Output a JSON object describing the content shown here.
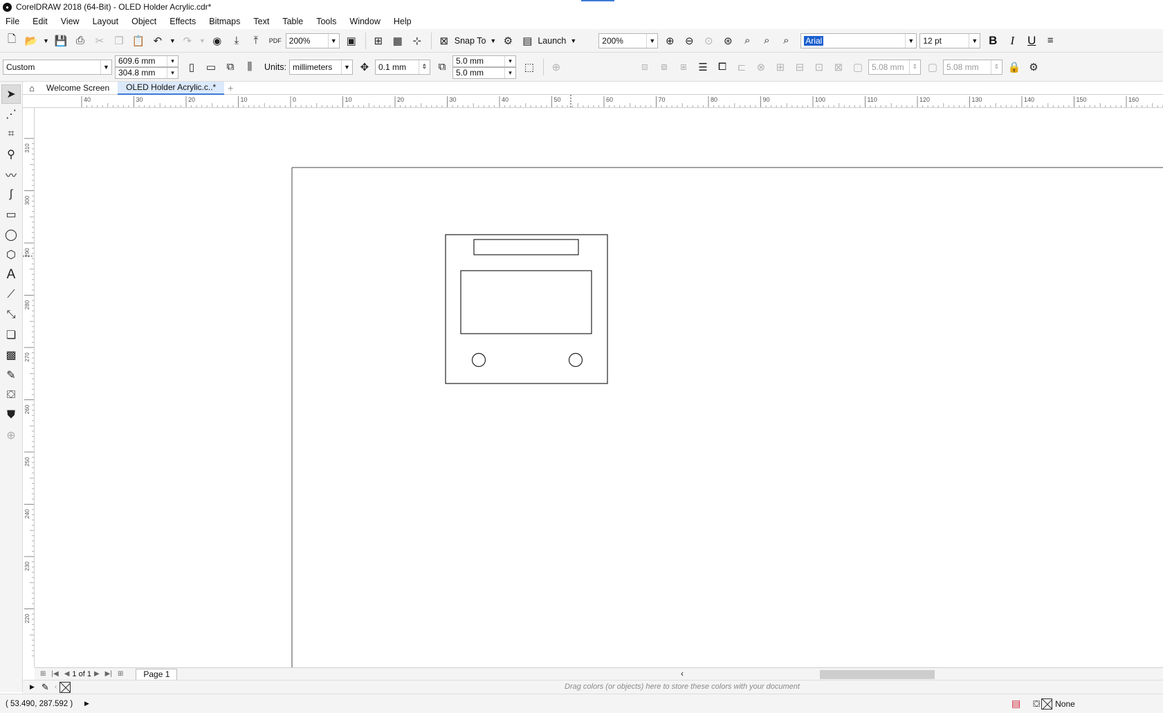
{
  "window": {
    "title": "CorelDRAW 2018 (64-Bit) - OLED Holder Acrylic.cdr*"
  },
  "menu": [
    "File",
    "Edit",
    "View",
    "Layout",
    "Object",
    "Effects",
    "Bitmaps",
    "Text",
    "Table",
    "Tools",
    "Window",
    "Help"
  ],
  "toolbar": {
    "zoom_combo": "200%",
    "snap_to": "Snap To",
    "launch": "Launch",
    "zoom_combo2": "200%",
    "font_name": "Arial",
    "font_size": "12 pt",
    "bold": "B",
    "italic": "I",
    "underline": "U"
  },
  "propbar": {
    "page_preset": "Custom",
    "width": "609.6 mm",
    "height": "304.8 mm",
    "units_label": "Units:",
    "units": "millimeters",
    "nudge": "0.1 mm",
    "dup_x": "5.0 mm",
    "dup_y": "5.0 mm",
    "corner1": "5.08 mm",
    "corner2": "5.08 mm"
  },
  "doc_tabs": {
    "welcome": "Welcome Screen",
    "document": "OLED Holder Acrylic.c..*"
  },
  "rulers": {
    "horizontal": [
      "40",
      "30",
      "20",
      "10",
      "0",
      "10",
      "20",
      "30",
      "40",
      "50",
      "60",
      "70",
      "80",
      "90",
      "100",
      "110",
      "120",
      "130",
      "140",
      "150",
      "160"
    ],
    "vertical": [
      "310",
      "300",
      "290",
      "280",
      "270",
      "260",
      "250",
      "240",
      "230",
      "220"
    ]
  },
  "page_nav": {
    "current": "1",
    "of_label": "of",
    "total": "1",
    "page_tab": "Page 1"
  },
  "palette": {
    "hint": "Drag colors (or objects) here to store these colors with your document"
  },
  "status": {
    "coords": "( 53.490, 287.592 )",
    "fill": "None"
  },
  "colors": {
    "accent": "#1a5fd0",
    "tab_active": "#dbe9fb",
    "chrome": "#f4f4f4"
  }
}
